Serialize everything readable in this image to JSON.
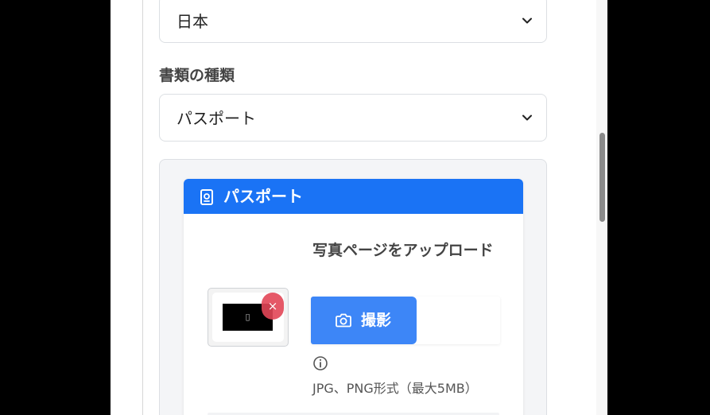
{
  "country_select": {
    "value": "日本"
  },
  "document_type": {
    "label": "書類の種類",
    "value": "パスポート"
  },
  "document_card": {
    "title": "パスポート",
    "upload_title": "写真ページをアップロード",
    "capture_label": "撮影",
    "remove_symbol": "×",
    "thumbnail_symbol": "▯",
    "format_note": "JPG、PNG形式（最大5MB）"
  },
  "colors": {
    "primary": "#1a73f5",
    "capture_button": "#3d86f7",
    "remove_button": "#e24656"
  },
  "icons": [
    "chevron-down-icon",
    "passport-icon",
    "camera-icon",
    "info-icon",
    "close-icon"
  ]
}
